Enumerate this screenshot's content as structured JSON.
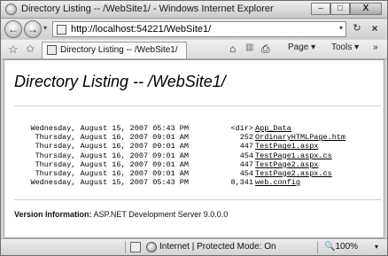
{
  "window": {
    "title": "Directory Listing -- /WebSite1/ - Windows Internet Explorer",
    "minimize": "–",
    "maximize": "□",
    "close": "X"
  },
  "address_bar": {
    "url": "http://localhost:54221/WebSite1/",
    "refresh": "↻",
    "stop": "×"
  },
  "nav": {
    "back": "←",
    "forward": "→",
    "dropdown": "▾"
  },
  "tab": {
    "label": "Directory Listing -- /WebSite1/"
  },
  "command_bar": {
    "home_icon": "home-icon",
    "home": "⌂",
    "feeds": "▥",
    "print": "⎙",
    "page": "Page",
    "tools": "Tools",
    "help": "»"
  },
  "page": {
    "heading": "Directory Listing -- /WebSite1/",
    "entries": [
      {
        "date": "Wednesday, August 15, 2007 05:43 PM",
        "size": "<dir>",
        "name": "App_Data"
      },
      {
        "date": "Thursday, August 16, 2007 09:01 AM",
        "size": "252",
        "name": "OrdinaryHTMLPage.htm"
      },
      {
        "date": "Thursday, August 16, 2007 09:01 AM",
        "size": "447",
        "name": "TestPage1.aspx"
      },
      {
        "date": "Thursday, August 16, 2007 09:01 AM",
        "size": "454",
        "name": "TestPage1.aspx.cs"
      },
      {
        "date": "Thursday, August 16, 2007 09:01 AM",
        "size": "447",
        "name": "TestPage2.aspx"
      },
      {
        "date": "Thursday, August 16, 2007 09:01 AM",
        "size": "454",
        "name": "TestPage2.aspx.cs"
      },
      {
        "date": "Wednesday, August 15, 2007 05:43 PM",
        "size": "8,341",
        "name": "web.config"
      }
    ],
    "version_label": "Version Information:",
    "version_value": "ASP.NET Development Server 9.0.0.0"
  },
  "status_bar": {
    "zone": "Internet | Protected Mode: On",
    "zoom": "100%"
  }
}
